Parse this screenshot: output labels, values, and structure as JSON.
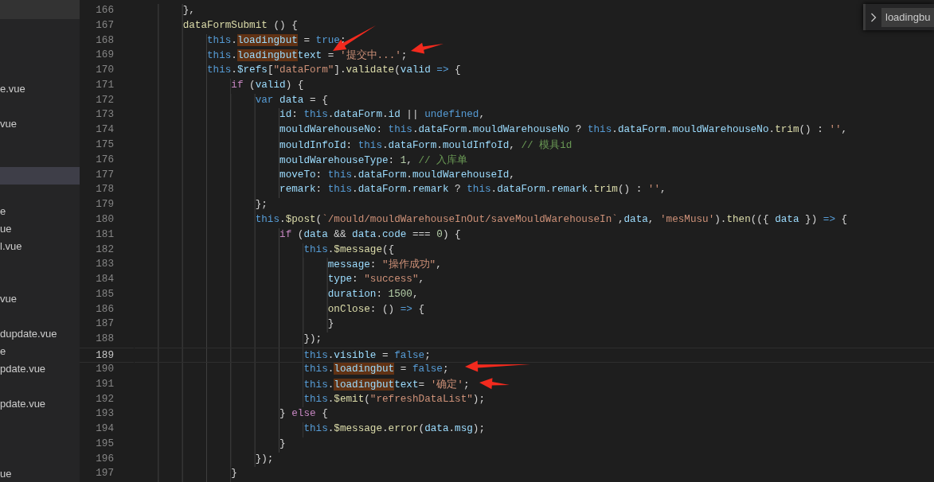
{
  "sidebar": {
    "items": [
      {
        "selected": false
      },
      {
        "selected": false
      },
      {
        "selected": false
      },
      {
        "name": "e.vue",
        "selected": false
      },
      {
        "selected": false
      },
      {
        "name": "vue",
        "selected": false
      },
      {
        "selected": false
      },
      {
        "selected": false
      },
      {
        "selected": true
      },
      {
        "selected": false
      },
      {
        "name": "e",
        "selected": false
      },
      {
        "name": "ue",
        "selected": false
      },
      {
        "name": "l.vue",
        "selected": false
      },
      {
        "selected": false
      },
      {
        "selected": false
      },
      {
        "name": "vue",
        "selected": false
      },
      {
        "selected": false
      },
      {
        "name": "dupdate.vue",
        "selected": false
      },
      {
        "name": "e",
        "selected": false
      },
      {
        "name": "pdate.vue",
        "selected": false
      },
      {
        "selected": false
      },
      {
        "name": "pdate.vue",
        "selected": false
      },
      {
        "selected": false
      },
      {
        "selected": false
      },
      {
        "selected": false
      },
      {
        "name": "ue",
        "selected": false
      }
    ]
  },
  "find_widget": {
    "value": "loadingbu"
  },
  "editor": {
    "lines": [
      {
        "number": "166",
        "current": false,
        "tokens": [
          {
            "text": "},",
            "kind": "plain"
          }
        ]
      },
      {
        "number": "167",
        "current": false,
        "tokens": [
          {
            "text": "dataFormSubmit",
            "kind": "function"
          },
          {
            "text": " () {",
            "kind": "plain"
          }
        ],
        "children": [
          {
            "number": "168",
            "current": false,
            "tokens": [
              {
                "text": "this",
                "kind": "keyword"
              },
              {
                "text": ".",
                "kind": "plain"
              },
              {
                "text": "loadingbut",
                "kind": "variable",
                "match": true
              },
              {
                "text": " = ",
                "kind": "plain"
              },
              {
                "text": "true",
                "kind": "keyword"
              },
              {
                "text": ";",
                "kind": "plain"
              }
            ]
          },
          {
            "number": "169",
            "current": false,
            "tokens": [
              {
                "text": "this",
                "kind": "keyword"
              },
              {
                "text": ".",
                "kind": "plain"
              },
              {
                "text": "loadingbut",
                "kind": "variable",
                "match": true
              },
              {
                "text": "text",
                "kind": "variable"
              },
              {
                "text": " = ",
                "kind": "plain"
              },
              {
                "text": "'提交中...'",
                "kind": "string"
              },
              {
                "text": ";",
                "kind": "plain"
              }
            ]
          },
          {
            "number": "170",
            "current": false,
            "tokens": [
              {
                "text": "this",
                "kind": "keyword"
              },
              {
                "text": ".",
                "kind": "plain"
              },
              {
                "text": "$refs",
                "kind": "variable"
              },
              {
                "text": "[",
                "kind": "plain"
              },
              {
                "text": "\"dataForm\"",
                "kind": "string"
              },
              {
                "text": "].",
                "kind": "plain"
              },
              {
                "text": "validate",
                "kind": "function"
              },
              {
                "text": "(",
                "kind": "plain"
              },
              {
                "text": "valid",
                "kind": "variable"
              },
              {
                "text": " =>",
                "kind": "keyword"
              },
              {
                "text": " {",
                "kind": "plain"
              }
            ],
            "children": [
              {
                "number": "171",
                "current": false,
                "tokens": [
                  {
                    "text": "if",
                    "kind": "control"
                  },
                  {
                    "text": " (",
                    "kind": "plain"
                  },
                  {
                    "text": "valid",
                    "kind": "variable"
                  },
                  {
                    "text": ") {",
                    "kind": "plain"
                  }
                ],
                "children": [
                  {
                    "number": "172",
                    "current": false,
                    "tokens": [
                      {
                        "text": "var",
                        "kind": "keyword"
                      },
                      {
                        "text": " data",
                        "kind": "variable"
                      },
                      {
                        "text": " = {",
                        "kind": "plain"
                      }
                    ],
                    "children": [
                      {
                        "number": "173",
                        "current": false,
                        "tokens": [
                          {
                            "text": "id",
                            "kind": "variable"
                          },
                          {
                            "text": ": ",
                            "kind": "plain"
                          },
                          {
                            "text": "this",
                            "kind": "keyword"
                          },
                          {
                            "text": ".",
                            "kind": "plain"
                          },
                          {
                            "text": "dataForm",
                            "kind": "variable"
                          },
                          {
                            "text": ".",
                            "kind": "plain"
                          },
                          {
                            "text": "id",
                            "kind": "variable"
                          },
                          {
                            "text": " || ",
                            "kind": "plain"
                          },
                          {
                            "text": "undefined",
                            "kind": "keyword"
                          },
                          {
                            "text": ",",
                            "kind": "plain"
                          }
                        ]
                      },
                      {
                        "number": "174",
                        "current": false,
                        "tokens": [
                          {
                            "text": "mouldWarehouseNo",
                            "kind": "variable"
                          },
                          {
                            "text": ": ",
                            "kind": "plain"
                          },
                          {
                            "text": "this",
                            "kind": "keyword"
                          },
                          {
                            "text": ".",
                            "kind": "plain"
                          },
                          {
                            "text": "dataForm",
                            "kind": "variable"
                          },
                          {
                            "text": ".",
                            "kind": "plain"
                          },
                          {
                            "text": "mouldWarehouseNo",
                            "kind": "variable"
                          },
                          {
                            "text": " ? ",
                            "kind": "plain"
                          },
                          {
                            "text": "this",
                            "kind": "keyword"
                          },
                          {
                            "text": ".",
                            "kind": "plain"
                          },
                          {
                            "text": "dataForm",
                            "kind": "variable"
                          },
                          {
                            "text": ".",
                            "kind": "plain"
                          },
                          {
                            "text": "mouldWarehouseNo",
                            "kind": "variable"
                          },
                          {
                            "text": ".",
                            "kind": "plain"
                          },
                          {
                            "text": "trim",
                            "kind": "function"
                          },
                          {
                            "text": "() : ",
                            "kind": "plain"
                          },
                          {
                            "text": "''",
                            "kind": "string"
                          },
                          {
                            "text": ",",
                            "kind": "plain"
                          }
                        ]
                      },
                      {
                        "number": "175",
                        "current": false,
                        "tokens": [
                          {
                            "text": "mouldInfoId",
                            "kind": "variable"
                          },
                          {
                            "text": ": ",
                            "kind": "plain"
                          },
                          {
                            "text": "this",
                            "kind": "keyword"
                          },
                          {
                            "text": ".",
                            "kind": "plain"
                          },
                          {
                            "text": "dataForm",
                            "kind": "variable"
                          },
                          {
                            "text": ".",
                            "kind": "plain"
                          },
                          {
                            "text": "mouldInfoId",
                            "kind": "variable"
                          },
                          {
                            "text": ", ",
                            "kind": "plain"
                          },
                          {
                            "text": "// 模具id",
                            "kind": "comment"
                          }
                        ]
                      },
                      {
                        "number": "176",
                        "current": false,
                        "tokens": [
                          {
                            "text": "mouldWarehouseType",
                            "kind": "variable"
                          },
                          {
                            "text": ": ",
                            "kind": "plain"
                          },
                          {
                            "text": "1",
                            "kind": "number"
                          },
                          {
                            "text": ", ",
                            "kind": "plain"
                          },
                          {
                            "text": "// 入库单",
                            "kind": "comment"
                          }
                        ]
                      },
                      {
                        "number": "177",
                        "current": false,
                        "tokens": [
                          {
                            "text": "moveTo",
                            "kind": "variable"
                          },
                          {
                            "text": ": ",
                            "kind": "plain"
                          },
                          {
                            "text": "this",
                            "kind": "keyword"
                          },
                          {
                            "text": ".",
                            "kind": "plain"
                          },
                          {
                            "text": "dataForm",
                            "kind": "variable"
                          },
                          {
                            "text": ".",
                            "kind": "plain"
                          },
                          {
                            "text": "mouldWarehouseId",
                            "kind": "variable"
                          },
                          {
                            "text": ",",
                            "kind": "plain"
                          }
                        ]
                      },
                      {
                        "number": "178",
                        "current": false,
                        "tokens": [
                          {
                            "text": "remark",
                            "kind": "variable"
                          },
                          {
                            "text": ": ",
                            "kind": "plain"
                          },
                          {
                            "text": "this",
                            "kind": "keyword"
                          },
                          {
                            "text": ".",
                            "kind": "plain"
                          },
                          {
                            "text": "dataForm",
                            "kind": "variable"
                          },
                          {
                            "text": ".",
                            "kind": "plain"
                          },
                          {
                            "text": "remark",
                            "kind": "variable"
                          },
                          {
                            "text": " ? ",
                            "kind": "plain"
                          },
                          {
                            "text": "this",
                            "kind": "keyword"
                          },
                          {
                            "text": ".",
                            "kind": "plain"
                          },
                          {
                            "text": "dataForm",
                            "kind": "variable"
                          },
                          {
                            "text": ".",
                            "kind": "plain"
                          },
                          {
                            "text": "remark",
                            "kind": "variable"
                          },
                          {
                            "text": ".",
                            "kind": "plain"
                          },
                          {
                            "text": "trim",
                            "kind": "function"
                          },
                          {
                            "text": "() : ",
                            "kind": "plain"
                          },
                          {
                            "text": "''",
                            "kind": "string"
                          },
                          {
                            "text": ",",
                            "kind": "plain"
                          }
                        ]
                      }
                    ]
                  },
                  {
                    "number": "179",
                    "current": false,
                    "tokens": [
                      {
                        "text": "};",
                        "kind": "plain"
                      }
                    ]
                  },
                  {
                    "number": "180",
                    "current": false,
                    "tokens": [
                      {
                        "text": "this",
                        "kind": "keyword"
                      },
                      {
                        "text": ".",
                        "kind": "plain"
                      },
                      {
                        "text": "$post",
                        "kind": "function"
                      },
                      {
                        "text": "(",
                        "kind": "plain"
                      },
                      {
                        "text": "`/mould/mouldWarehouseInOut/saveMouldWarehouseIn`",
                        "kind": "string"
                      },
                      {
                        "text": ",",
                        "kind": "plain"
                      },
                      {
                        "text": "data",
                        "kind": "variable"
                      },
                      {
                        "text": ", ",
                        "kind": "plain"
                      },
                      {
                        "text": "'mesMusu'",
                        "kind": "string"
                      },
                      {
                        "text": ").",
                        "kind": "plain"
                      },
                      {
                        "text": "then",
                        "kind": "function"
                      },
                      {
                        "text": "(({ ",
                        "kind": "plain"
                      },
                      {
                        "text": "data",
                        "kind": "variable"
                      },
                      {
                        "text": " }) ",
                        "kind": "plain"
                      },
                      {
                        "text": "=>",
                        "kind": "keyword"
                      },
                      {
                        "text": " {",
                        "kind": "plain"
                      }
                    ],
                    "children": [
                      {
                        "number": "181",
                        "current": false,
                        "tokens": [
                          {
                            "text": "if",
                            "kind": "control"
                          },
                          {
                            "text": " (",
                            "kind": "plain"
                          },
                          {
                            "text": "data",
                            "kind": "variable"
                          },
                          {
                            "text": " && ",
                            "kind": "plain"
                          },
                          {
                            "text": "data",
                            "kind": "variable"
                          },
                          {
                            "text": ".",
                            "kind": "plain"
                          },
                          {
                            "text": "code",
                            "kind": "variable"
                          },
                          {
                            "text": " === ",
                            "kind": "plain"
                          },
                          {
                            "text": "0",
                            "kind": "number"
                          },
                          {
                            "text": ") {",
                            "kind": "plain"
                          }
                        ],
                        "children": [
                          {
                            "number": "182",
                            "current": false,
                            "tokens": [
                              {
                                "text": "this",
                                "kind": "keyword"
                              },
                              {
                                "text": ".",
                                "kind": "plain"
                              },
                              {
                                "text": "$message",
                                "kind": "function"
                              },
                              {
                                "text": "({",
                                "kind": "plain"
                              }
                            ],
                            "children": [
                              {
                                "number": "183",
                                "current": false,
                                "tokens": [
                                  {
                                    "text": "message",
                                    "kind": "variable"
                                  },
                                  {
                                    "text": ": ",
                                    "kind": "plain"
                                  },
                                  {
                                    "text": "\"操作成功\"",
                                    "kind": "string"
                                  },
                                  {
                                    "text": ",",
                                    "kind": "plain"
                                  }
                                ]
                              },
                              {
                                "number": "184",
                                "current": false,
                                "tokens": [
                                  {
                                    "text": "type",
                                    "kind": "variable"
                                  },
                                  {
                                    "text": ": ",
                                    "kind": "plain"
                                  },
                                  {
                                    "text": "\"success\"",
                                    "kind": "string"
                                  },
                                  {
                                    "text": ",",
                                    "kind": "plain"
                                  }
                                ]
                              },
                              {
                                "number": "185",
                                "current": false,
                                "tokens": [
                                  {
                                    "text": "duration",
                                    "kind": "variable"
                                  },
                                  {
                                    "text": ": ",
                                    "kind": "plain"
                                  },
                                  {
                                    "text": "1500",
                                    "kind": "number"
                                  },
                                  {
                                    "text": ",",
                                    "kind": "plain"
                                  }
                                ]
                              },
                              {
                                "number": "186",
                                "current": false,
                                "tokens": [
                                  {
                                    "text": "onClose",
                                    "kind": "function"
                                  },
                                  {
                                    "text": ": () ",
                                    "kind": "plain"
                                  },
                                  {
                                    "text": "=>",
                                    "kind": "keyword"
                                  },
                                  {
                                    "text": " {",
                                    "kind": "plain"
                                  }
                                ]
                              },
                              {
                                "number": "187",
                                "current": false,
                                "tokens": [
                                  {
                                    "text": "}",
                                    "kind": "plain"
                                  }
                                ]
                              }
                            ]
                          },
                          {
                            "number": "188",
                            "current": false,
                            "tokens": [
                              {
                                "text": "});",
                                "kind": "plain"
                              }
                            ]
                          },
                          {
                            "number": "189",
                            "current": true,
                            "tokens": [
                              {
                                "text": "this",
                                "kind": "keyword"
                              },
                              {
                                "text": ".",
                                "kind": "plain"
                              },
                              {
                                "text": "visible",
                                "kind": "variable"
                              },
                              {
                                "text": " = ",
                                "kind": "plain"
                              },
                              {
                                "text": "false",
                                "kind": "keyword"
                              },
                              {
                                "text": ";",
                                "kind": "plain"
                              }
                            ]
                          },
                          {
                            "number": "190",
                            "current": false,
                            "tokens": [
                              {
                                "text": "this",
                                "kind": "keyword"
                              },
                              {
                                "text": ".",
                                "kind": "plain"
                              },
                              {
                                "text": "loadingbut",
                                "kind": "variable",
                                "match": true
                              },
                              {
                                "text": " = ",
                                "kind": "plain"
                              },
                              {
                                "text": "false",
                                "kind": "keyword"
                              },
                              {
                                "text": ";",
                                "kind": "plain"
                              }
                            ]
                          },
                          {
                            "number": "191",
                            "current": false,
                            "tokens": [
                              {
                                "text": "this",
                                "kind": "keyword"
                              },
                              {
                                "text": ".",
                                "kind": "plain"
                              },
                              {
                                "text": "loadingbut",
                                "kind": "variable",
                                "match": true
                              },
                              {
                                "text": "text",
                                "kind": "variable"
                              },
                              {
                                "text": "= ",
                                "kind": "plain"
                              },
                              {
                                "text": "'确定'",
                                "kind": "string"
                              },
                              {
                                "text": ";",
                                "kind": "plain"
                              }
                            ]
                          },
                          {
                            "number": "192",
                            "current": false,
                            "tokens": [
                              {
                                "text": "this",
                                "kind": "keyword"
                              },
                              {
                                "text": ".",
                                "kind": "plain"
                              },
                              {
                                "text": "$emit",
                                "kind": "function"
                              },
                              {
                                "text": "(",
                                "kind": "plain"
                              },
                              {
                                "text": "\"refreshDataList\"",
                                "kind": "string"
                              },
                              {
                                "text": ");",
                                "kind": "plain"
                              }
                            ]
                          }
                        ]
                      },
                      {
                        "number": "193",
                        "current": false,
                        "tokens": [
                          {
                            "text": "} ",
                            "kind": "plain"
                          },
                          {
                            "text": "else",
                            "kind": "control"
                          },
                          {
                            "text": " {",
                            "kind": "plain"
                          }
                        ],
                        "children": [
                          {
                            "number": "194",
                            "current": false,
                            "tokens": [
                              {
                                "text": "this",
                                "kind": "keyword"
                              },
                              {
                                "text": ".",
                                "kind": "plain"
                              },
                              {
                                "text": "$message",
                                "kind": "function"
                              },
                              {
                                "text": ".",
                                "kind": "plain"
                              },
                              {
                                "text": "error",
                                "kind": "function"
                              },
                              {
                                "text": "(",
                                "kind": "plain"
                              },
                              {
                                "text": "data",
                                "kind": "variable"
                              },
                              {
                                "text": ".",
                                "kind": "plain"
                              },
                              {
                                "text": "msg",
                                "kind": "variable"
                              },
                              {
                                "text": ");",
                                "kind": "plain"
                              }
                            ]
                          }
                        ]
                      },
                      {
                        "number": "195",
                        "current": false,
                        "tokens": [
                          {
                            "text": "}",
                            "kind": "plain"
                          }
                        ]
                      }
                    ]
                  },
                  {
                    "number": "196",
                    "current": false,
                    "tokens": [
                      {
                        "text": "});",
                        "kind": "plain"
                      }
                    ]
                  }
                ]
              },
              {
                "number": "197",
                "current": false,
                "tokens": [
                  {
                    "text": "}",
                    "kind": "plain"
                  }
                ]
              }
            ]
          }
        ]
      }
    ]
  }
}
